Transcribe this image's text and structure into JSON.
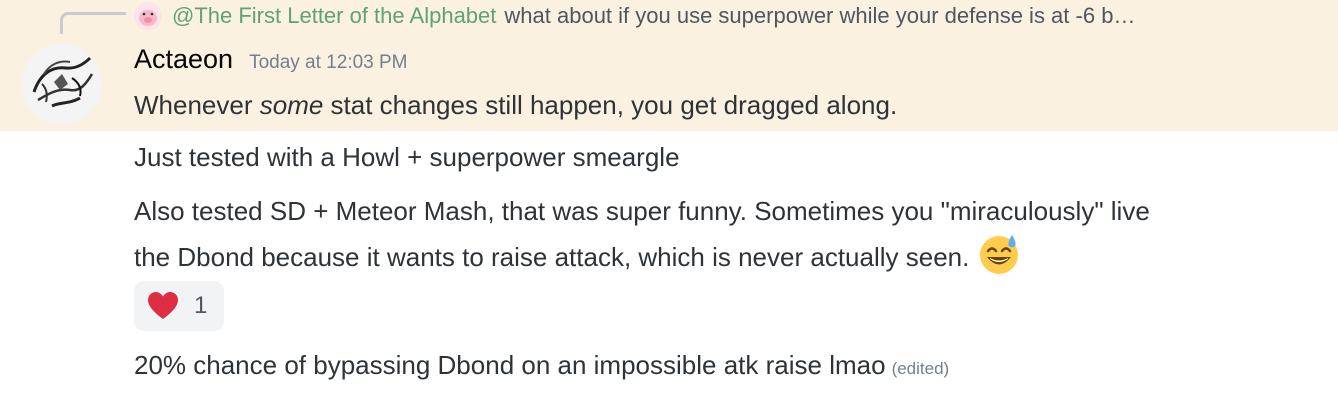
{
  "reply": {
    "author": "@The First Letter of the Alphabet",
    "text": "what about if you use superpower while your defense is at -6 b…"
  },
  "message_header": {
    "username": "Actaeon",
    "timestamp": "Today at 12:03 PM"
  },
  "messages": {
    "m1_before": "Whenever ",
    "m1_em": "some",
    "m1_after": " stat changes still happen, you get dragged along.",
    "m2": "Just tested with a Howl + superpower smeargle",
    "m3_line1": "Also tested SD + Meteor Mash, that was super funny. Sometimes you \"miraculously\" live",
    "m3_line2": "the Dbond because it wants to raise attack, which is never actually seen.",
    "m4": "20% chance of bypassing Dbond on an impossible atk raise lmao",
    "m4_edited": "(edited)"
  },
  "reaction": {
    "icon": "red-heart-icon",
    "count": "1"
  },
  "colors": {
    "highlight_bg": "#fbf1e0",
    "reply_author": "#5fa275",
    "heart": "#dd2e44",
    "emoji_face": "#ffcc4d"
  }
}
